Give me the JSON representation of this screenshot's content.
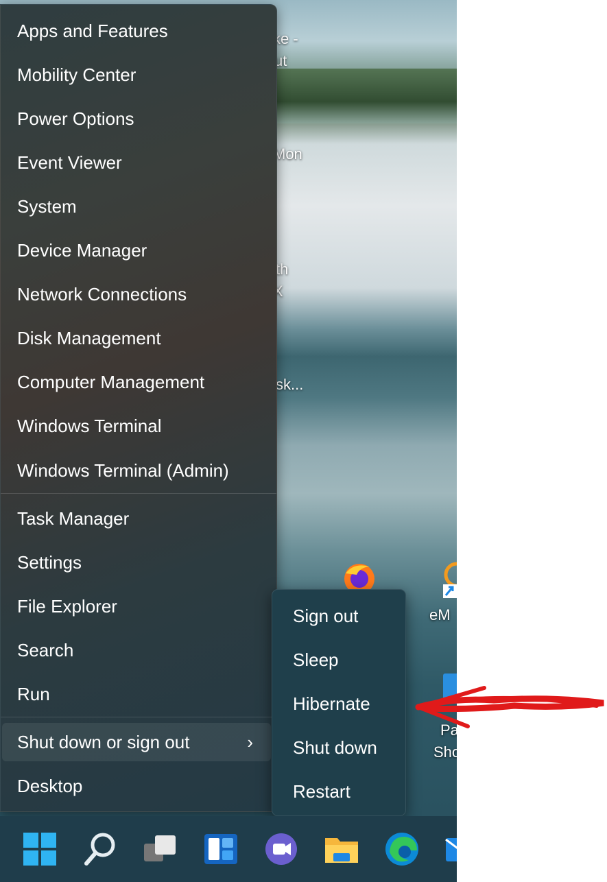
{
  "menu": {
    "items": [
      {
        "label": "Apps and Features"
      },
      {
        "label": "Mobility Center"
      },
      {
        "label": "Power Options"
      },
      {
        "label": "Event Viewer"
      },
      {
        "label": "System"
      },
      {
        "label": "Device Manager"
      },
      {
        "label": "Network Connections"
      },
      {
        "label": "Disk Management"
      },
      {
        "label": "Computer Management"
      },
      {
        "label": "Windows Terminal"
      },
      {
        "label": "Windows Terminal (Admin)"
      },
      {
        "label": "Task Manager"
      },
      {
        "label": "Settings"
      },
      {
        "label": "File Explorer"
      },
      {
        "label": "Search"
      },
      {
        "label": "Run"
      },
      {
        "label": "Shut down or sign out"
      },
      {
        "label": "Desktop"
      }
    ],
    "chevron": "›"
  },
  "submenu": {
    "items": [
      {
        "label": "Sign out"
      },
      {
        "label": "Sleep"
      },
      {
        "label": "Hibernate"
      },
      {
        "label": "Shut down"
      },
      {
        "label": "Restart"
      }
    ]
  },
  "desktop": {
    "fragments": [
      "ke -",
      "ut",
      "Mon",
      "th",
      "X",
      "sk...",
      "eM",
      "Pa",
      "Sho"
    ]
  },
  "taskbar": {
    "icons": [
      "windows-start-icon",
      "search-icon",
      "task-view-icon",
      "widgets-icon",
      "teams-chat-icon",
      "file-explorer-icon",
      "edge-icon",
      "mail-icon"
    ]
  },
  "colors": {
    "menu_bg": "#2f3d40",
    "submenu_bg": "#1f3f4b",
    "taskbar_bg": "#1f3d4b",
    "annotation": "#e01a1a",
    "windows_blue": "#2fb4f2"
  }
}
